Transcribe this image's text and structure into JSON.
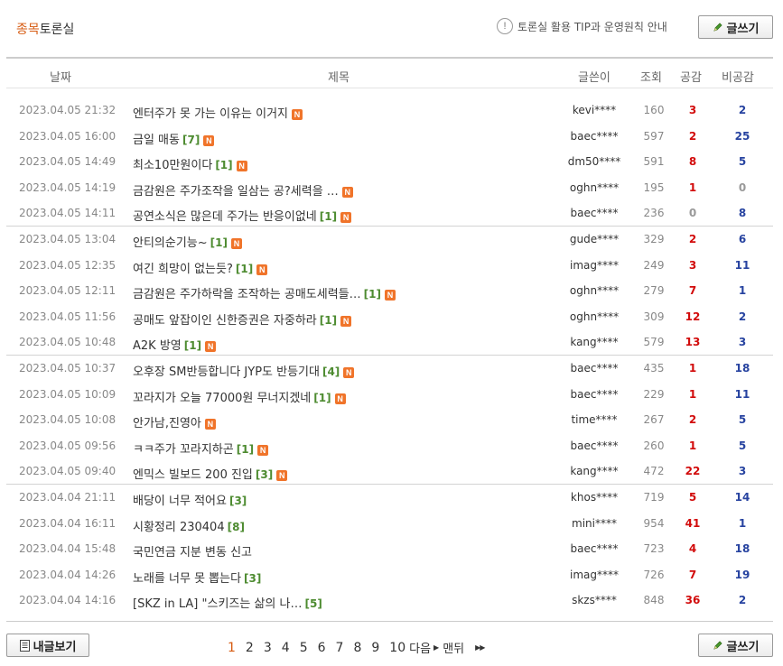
{
  "header": {
    "title_accent": "종목",
    "title_rest": "토론실",
    "tip_text": "토론실 활용 TIP과 운영원칙 안내",
    "write_label": "글쓰기"
  },
  "columns": {
    "date": "날짜",
    "title": "제목",
    "author": "글쓴이",
    "views": "조회",
    "agree": "공감",
    "disagree": "비공감"
  },
  "posts": [
    {
      "date": "2023.04.05 21:32",
      "title": "엔터주가 못 가는 이유는 이거지",
      "comments": "",
      "new": "N",
      "author": "kevi****",
      "views": "160",
      "agree": "3",
      "disagree": "2"
    },
    {
      "date": "2023.04.05 16:00",
      "title": "금일 매동",
      "comments": "[7]",
      "new": "N",
      "author": "baec****",
      "views": "597",
      "agree": "2",
      "disagree": "25"
    },
    {
      "date": "2023.04.05 14:49",
      "title": "최소10만원이다",
      "comments": "[1]",
      "new": "N",
      "author": "dm50****",
      "views": "591",
      "agree": "8",
      "disagree": "5"
    },
    {
      "date": "2023.04.05 14:19",
      "title": "금감원은 주가조작을 일삼는 공?세력을 …",
      "comments": "",
      "new": "N",
      "author": "oghn****",
      "views": "195",
      "agree": "1",
      "disagree": "0"
    },
    {
      "date": "2023.04.05 14:11",
      "title": "공연소식은 많은데 주가는 반응이없네",
      "comments": "[1]",
      "new": "N",
      "author": "baec****",
      "views": "236",
      "agree": "0",
      "disagree": "8"
    },
    {
      "date": "2023.04.05 13:04",
      "title": "안티의순기능~",
      "comments": "[1]",
      "new": "N",
      "author": "gude****",
      "views": "329",
      "agree": "2",
      "disagree": "6"
    },
    {
      "date": "2023.04.05 12:35",
      "title": "여긴 희망이 없는듯?",
      "comments": "[1]",
      "new": "N",
      "author": "imag****",
      "views": "249",
      "agree": "3",
      "disagree": "11"
    },
    {
      "date": "2023.04.05 12:11",
      "title": "금감원은 주가하락을 조작하는 공매도세력들…",
      "comments": "[1]",
      "new": "N",
      "author": "oghn****",
      "views": "279",
      "agree": "7",
      "disagree": "1"
    },
    {
      "date": "2023.04.05 11:56",
      "title": "공매도 앞잡이인 신한증권은 자중하라",
      "comments": "[1]",
      "new": "N",
      "author": "oghn****",
      "views": "309",
      "agree": "12",
      "disagree": "2"
    },
    {
      "date": "2023.04.05 10:48",
      "title": "A2K 방영",
      "comments": "[1]",
      "new": "N",
      "author": "kang****",
      "views": "579",
      "agree": "13",
      "disagree": "3"
    },
    {
      "date": "2023.04.05 10:37",
      "title": "오후장 SM반등합니다 JYP도 반등기대",
      "comments": "[4]",
      "new": "N",
      "author": "baec****",
      "views": "435",
      "agree": "1",
      "disagree": "18"
    },
    {
      "date": "2023.04.05 10:09",
      "title": "꼬라지가 오늘 77000원 무너지겠네",
      "comments": "[1]",
      "new": "N",
      "author": "baec****",
      "views": "229",
      "agree": "1",
      "disagree": "11"
    },
    {
      "date": "2023.04.05 10:08",
      "title": "안가남,진영아",
      "comments": "",
      "new": "N",
      "author": "time****",
      "views": "267",
      "agree": "2",
      "disagree": "5"
    },
    {
      "date": "2023.04.05 09:56",
      "title": "ㅋㅋ주가 꼬라지하곤",
      "comments": "[1]",
      "new": "N",
      "author": "baec****",
      "views": "260",
      "agree": "1",
      "disagree": "5"
    },
    {
      "date": "2023.04.05 09:40",
      "title": "엔믹스 빌보드 200 진입",
      "comments": "[3]",
      "new": "N",
      "author": "kang****",
      "views": "472",
      "agree": "22",
      "disagree": "3"
    },
    {
      "date": "2023.04.04 21:11",
      "title": "배당이 너무 적어요",
      "comments": "[3]",
      "new": "",
      "author": "khos****",
      "views": "719",
      "agree": "5",
      "disagree": "14"
    },
    {
      "date": "2023.04.04 16:11",
      "title": "시황정리 230404",
      "comments": "[8]",
      "new": "",
      "author": "mini****",
      "views": "954",
      "agree": "41",
      "disagree": "1"
    },
    {
      "date": "2023.04.04 15:48",
      "title": "국민연금 지분 변동 신고",
      "comments": "",
      "new": "",
      "author": "baec****",
      "views": "723",
      "agree": "4",
      "disagree": "18"
    },
    {
      "date": "2023.04.04 14:26",
      "title": "노래를 너무 못 뽑는다",
      "comments": "[3]",
      "new": "",
      "author": "imag****",
      "views": "726",
      "agree": "7",
      "disagree": "19"
    },
    {
      "date": "2023.04.04 14:16",
      "title": "[SKZ in LA] \"스키즈는 삶의 나…",
      "comments": "[5]",
      "new": "",
      "author": "skzs****",
      "views": "848",
      "agree": "36",
      "disagree": "2"
    }
  ],
  "footer": {
    "my_posts_label": "내글보기",
    "write_label": "글쓰기",
    "pages": [
      "1",
      "2",
      "3",
      "4",
      "5",
      "6",
      "7",
      "8",
      "9",
      "10"
    ],
    "current_page": "1",
    "next_label": "다음",
    "last_label": "맨뒤"
  }
}
